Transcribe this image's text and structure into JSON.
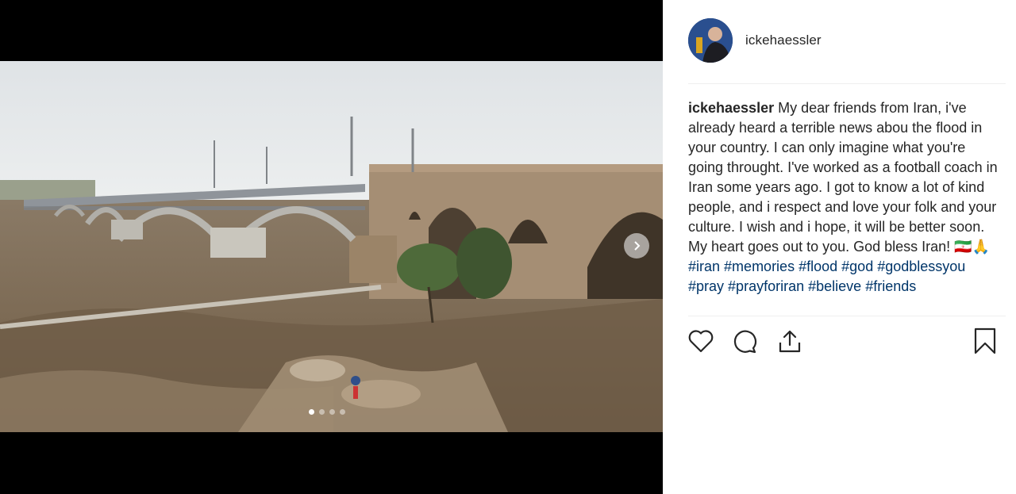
{
  "post": {
    "username": "ickehaessler",
    "caption": {
      "author": "ickehaessler",
      "text": "My dear friends from Iran, i've already heard a terrible news abou the flood in your country. I can only imagine what you're going throught. I've worked as a football coach in Iran some years ago. I got to know a lot of kind people, and i respect and love your folk and your culture. I wish and i hope, it will be better soon. My heart goes out to you. God bless Iran!",
      "emoji": "🇮🇷🙏",
      "hashtags": [
        "#iran",
        "#memories",
        "#flood",
        "#god",
        "#godblessyou",
        "#pray",
        "#prayforiran",
        "#believe",
        "#friends"
      ]
    },
    "carousel": {
      "total": 4,
      "active": 1
    }
  },
  "icons": {
    "like": "heart-icon",
    "comment": "comment-icon",
    "share": "share-icon",
    "save": "bookmark-icon",
    "next": "chevron-right-icon"
  },
  "colors": {
    "hashtag": "#003569",
    "text": "#262626"
  }
}
